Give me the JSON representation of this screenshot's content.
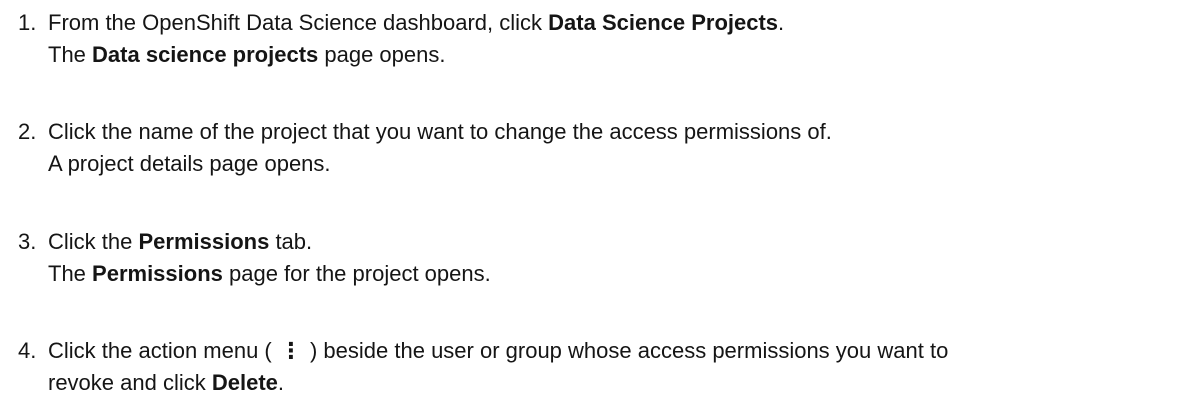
{
  "steps": [
    {
      "number": "1.",
      "main": {
        "prefix": "From the OpenShift Data Science dashboard, click ",
        "bold": "Data Science Projects",
        "suffix": "."
      },
      "result": {
        "prefix": "The ",
        "bold": "Data science projects",
        "suffix": " page opens."
      }
    },
    {
      "number": "2.",
      "main": {
        "text": "Click the name of the project that you want to change the access permissions of."
      },
      "result": {
        "text": "A project details page opens."
      }
    },
    {
      "number": "3.",
      "main": {
        "prefix": "Click the ",
        "bold": "Permissions",
        "suffix": " tab."
      },
      "result": {
        "prefix": "The ",
        "bold": "Permissions",
        "suffix": " page for the project opens."
      }
    },
    {
      "number": "4.",
      "main": {
        "prefix": "Click the action menu ( ",
        "icon": "⋮",
        "middle": " ) beside the user or group whose access permissions you want to",
        "line2_prefix": "revoke and click ",
        "bold": "Delete",
        "suffix": "."
      }
    }
  ]
}
